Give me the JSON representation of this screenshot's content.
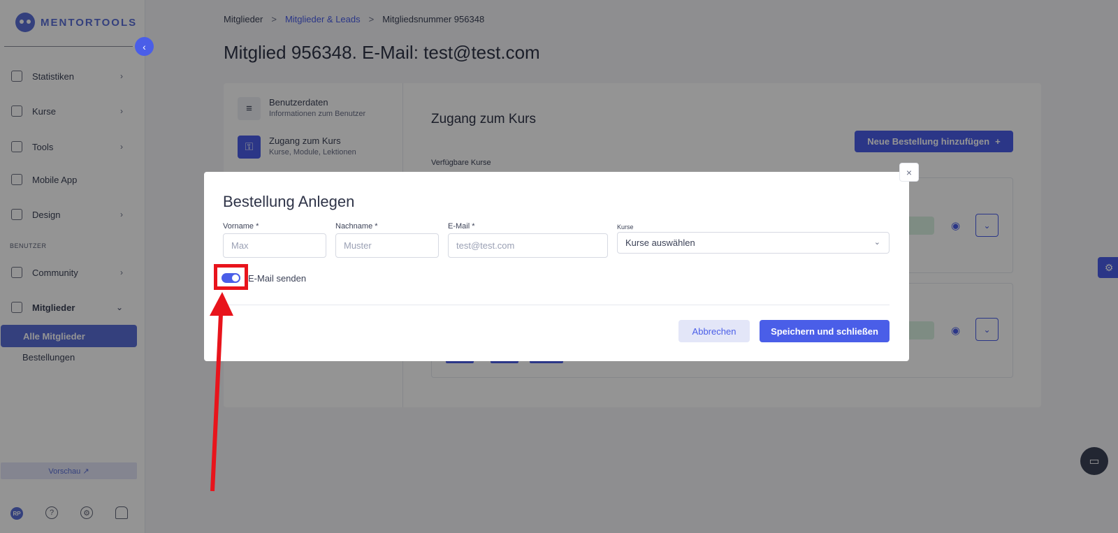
{
  "sidebar": {
    "logo_text": "MENTORTOOLS",
    "collapse_icon": "chevron-left-icon",
    "items": [
      {
        "label": "Statistiken",
        "icon": "bar-chart-icon"
      },
      {
        "label": "Kurse",
        "icon": "book-icon"
      },
      {
        "label": "Tools",
        "icon": "megaphone-icon"
      },
      {
        "label": "Mobile App",
        "icon": "phone-icon"
      },
      {
        "label": "Design",
        "icon": "pencil-icon"
      }
    ],
    "section_label": "BENUTZER",
    "section_items": [
      {
        "label": "Community",
        "icon": "users-icon"
      },
      {
        "label": "Mitglieder",
        "icon": "user-icon"
      }
    ],
    "sub_items": {
      "active": "Alle Mitglieder",
      "other": "Bestellungen"
    },
    "preview_label": "Vorschau ↗",
    "avatar_initials": "RP"
  },
  "breadcrumb": {
    "item1": "Mitglieder",
    "item2": "Mitglieder & Leads",
    "item3": "Mitgliedsnummer 956348",
    "sep": ">"
  },
  "page_title": "Mitglied 956348. E-Mail: test@test.com",
  "left_menu": [
    {
      "title": "Benutzerdaten",
      "subtitle": "Informationen zum Benutzer",
      "icon": "database-icon"
    },
    {
      "title": "Zugang zum Kurs",
      "subtitle": "Kurse, Module, Lektionen",
      "icon": "lock-icon"
    }
  ],
  "zugang": {
    "title": "Zugang zum Kurs",
    "new_order_button": "Neue Bestellung hinzufügen",
    "new_order_icon": "+",
    "available_label": "Verfügbare Kurse"
  },
  "modal": {
    "title": "Bestellung Anlegen",
    "close_icon": "×",
    "fields": {
      "vorname": {
        "label": "Vorname *",
        "placeholder": "Max"
      },
      "nachname": {
        "label": "Nachname *",
        "placeholder": "Muster"
      },
      "email": {
        "label": "E-Mail *",
        "placeholder": "test@test.com"
      },
      "kurse": {
        "label": "Kurse",
        "value": "Kurse auswählen"
      }
    },
    "toggle": {
      "label": "E-Mail senden",
      "on": true
    },
    "cancel_label": "Abbrechen",
    "save_label": "Speichern und schließen"
  },
  "colors": {
    "accent": "#4a5ee8",
    "annotation": "#e8141c"
  }
}
